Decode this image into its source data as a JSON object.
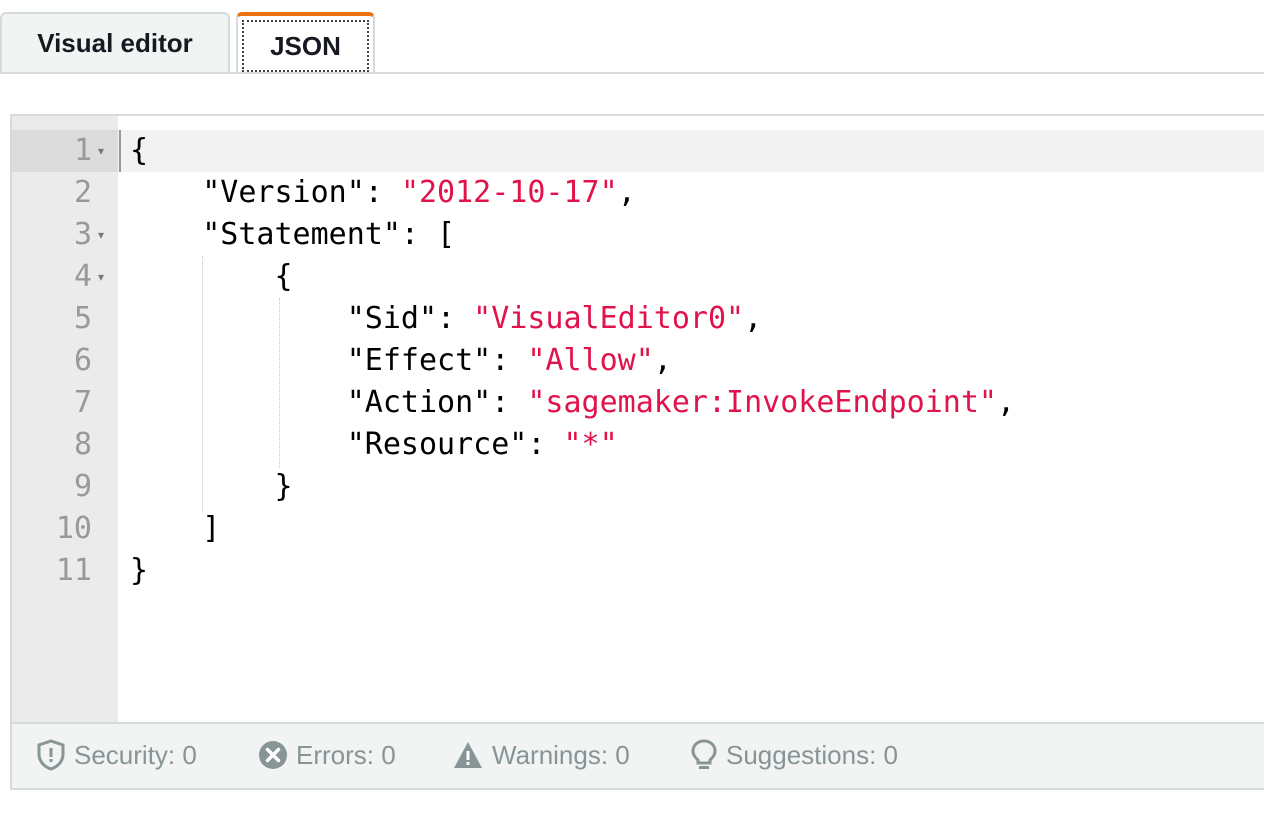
{
  "tabs": {
    "visual_editor": "Visual editor",
    "json": "JSON"
  },
  "editor": {
    "line_numbers": [
      "1",
      "2",
      "3",
      "4",
      "5",
      "6",
      "7",
      "8",
      "9",
      "10",
      "11"
    ],
    "lines": {
      "l1": {
        "p1": "{"
      },
      "l2": {
        "p1": "    \"Version\": ",
        "s1": "\"2012-10-17\"",
        "p2": ","
      },
      "l3": {
        "p1": "    \"Statement\": ["
      },
      "l4": {
        "p1": "        {"
      },
      "l5": {
        "p1": "            \"Sid\": ",
        "s1": "\"VisualEditor0\"",
        "p2": ","
      },
      "l6": {
        "p1": "            \"Effect\": ",
        "s1": "\"Allow\"",
        "p2": ","
      },
      "l7": {
        "p1": "            \"Action\": ",
        "s1": "\"sagemaker:InvokeEndpoint\"",
        "p2": ","
      },
      "l8": {
        "p1": "            \"Resource\": ",
        "s1": "\"*\""
      },
      "l9": {
        "p1": "        }"
      },
      "l10": {
        "p1": "    ]"
      },
      "l11": {
        "p1": "}"
      }
    }
  },
  "status": {
    "security": "Security: 0",
    "errors": "Errors: 0",
    "warnings": "Warnings: 0",
    "suggestions": "Suggestions: 0"
  },
  "colors": {
    "accent": "#ec7211",
    "string": "#e0134b",
    "status_text": "#879596"
  },
  "icons": [
    "shield-icon",
    "error-circle-icon",
    "warning-triangle-icon",
    "lightbulb-icon",
    "fold-arrow-icon"
  ]
}
